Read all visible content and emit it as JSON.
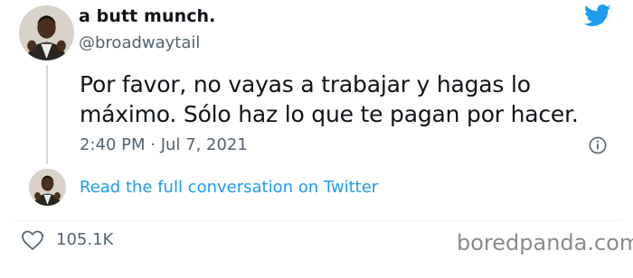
{
  "tweet": {
    "display_name": "a butt munch.",
    "handle": "@broadwaytail",
    "text_line1": "Por favor, no vayas a trabajar y hagas lo",
    "text_line2": "máximo. Sólo haz lo que te pagan por hacer.",
    "timestamp": "2:40 PM · Jul 7, 2021",
    "full_conversation_link": "Read the full conversation on Twitter",
    "like_count": "105.1K"
  },
  "icons": {
    "brand": "twitter-bird-icon",
    "info": "info-icon",
    "like": "heart-icon"
  },
  "colors": {
    "brand_blue": "#1d9bf0",
    "text_primary": "#0f1419",
    "text_secondary": "#536471"
  },
  "watermark": "boredpanda.com"
}
